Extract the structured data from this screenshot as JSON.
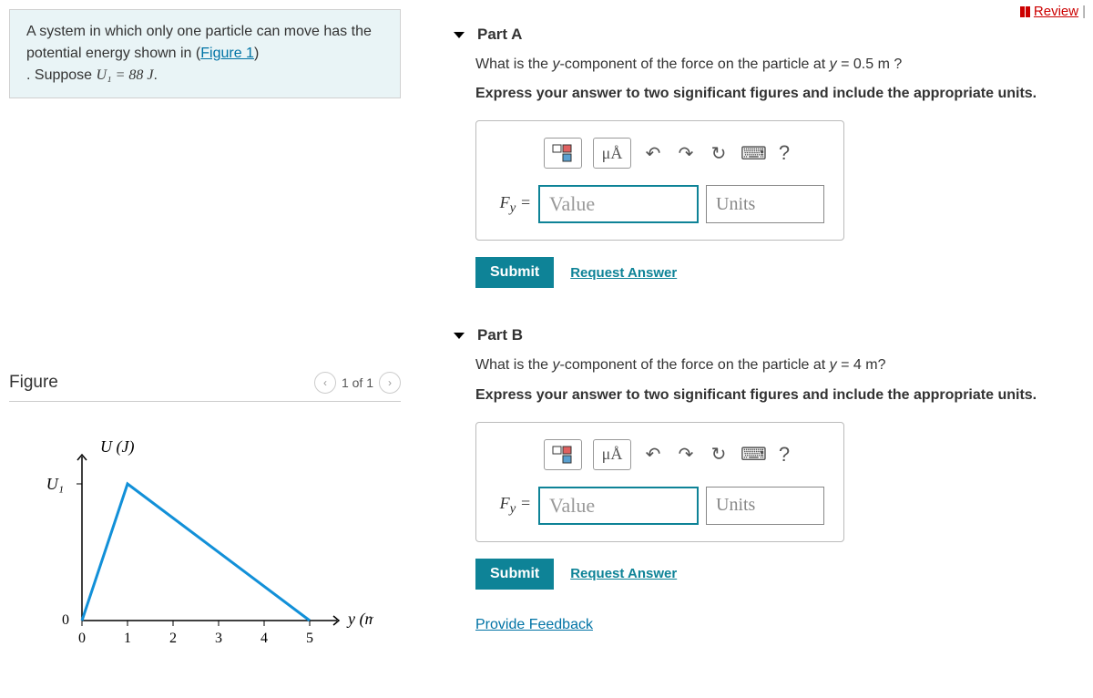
{
  "header": {
    "review_label": "Review"
  },
  "problem": {
    "line1": "A system in which only one particle can move has the potential energy shown in (",
    "fig_link": "Figure 1",
    "line1_tail": ")",
    "line2_prefix": ". Suppose ",
    "u1": "U₁ = 88 J",
    "line2_tail": "."
  },
  "figure": {
    "title": "Figure",
    "counter": "1 of 1"
  },
  "chart_data": {
    "type": "line",
    "title": "",
    "xlabel": "y (m)",
    "ylabel": "U (J)",
    "x": [
      0,
      1,
      5
    ],
    "y_symbolic": [
      0,
      "U1",
      0
    ],
    "y_numeric": [
      0,
      88,
      0
    ],
    "xlim": [
      0,
      5
    ],
    "x_ticks": [
      0,
      1,
      2,
      3,
      4,
      5
    ],
    "y_ticks_labels": [
      "0",
      "U₁"
    ],
    "grid": false
  },
  "parts": [
    {
      "id": "A",
      "header": "Part A",
      "question": "What is the y-component of the force on the particle at y = 0.5 m ?",
      "instruction": "Express your answer to two significant figures and include the appropriate units.",
      "toolbar": {
        "symbol": "μÅ",
        "help": "?"
      },
      "answer_label": "Fᵧ =",
      "value_placeholder": "Value",
      "units_placeholder": "Units",
      "submit_label": "Submit",
      "request_ans_label": "Request Answer"
    },
    {
      "id": "B",
      "header": "Part B",
      "question": "What is the y-component of the force on the particle at y = 4 m?",
      "instruction": "Express your answer to two significant figures and include the appropriate units.",
      "toolbar": {
        "symbol": "μÅ",
        "help": "?"
      },
      "answer_label": "Fᵧ =",
      "value_placeholder": "Value",
      "units_placeholder": "Units",
      "submit_label": "Submit",
      "request_ans_label": "Request Answer"
    }
  ],
  "feedback_label": "Provide Feedback"
}
